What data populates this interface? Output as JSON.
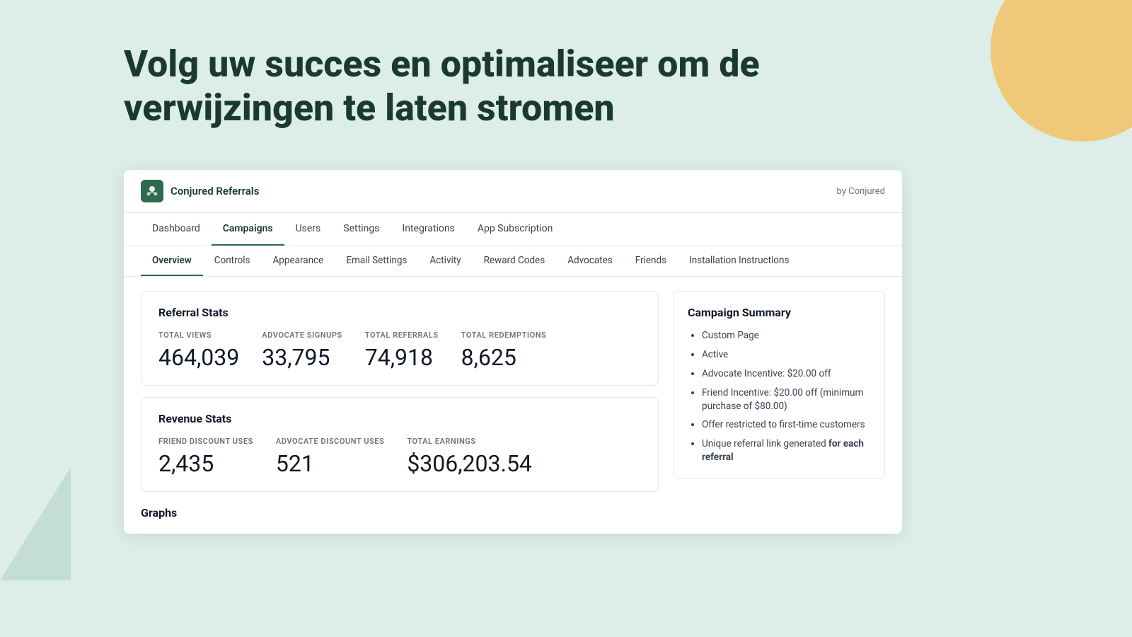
{
  "page": {
    "background_color": "#ddeee8"
  },
  "hero": {
    "title": "Volg uw succes en optimaliseer om de verwijzingen te laten stromen"
  },
  "app": {
    "logo_label": "Conjured Referrals",
    "byline": "by Conjured",
    "top_nav": {
      "items": [
        {
          "label": "Dashboard",
          "active": false
        },
        {
          "label": "Campaigns",
          "active": true
        },
        {
          "label": "Users",
          "active": false
        },
        {
          "label": "Settings",
          "active": false
        },
        {
          "label": "Integrations",
          "active": false
        },
        {
          "label": "App Subscription",
          "active": false
        }
      ]
    },
    "secondary_nav": {
      "items": [
        {
          "label": "Overview",
          "active": true
        },
        {
          "label": "Controls",
          "active": false
        },
        {
          "label": "Appearance",
          "active": false
        },
        {
          "label": "Email Settings",
          "active": false
        },
        {
          "label": "Activity",
          "active": false
        },
        {
          "label": "Reward Codes",
          "active": false
        },
        {
          "label": "Advocates",
          "active": false
        },
        {
          "label": "Friends",
          "active": false
        },
        {
          "label": "Installation Instructions",
          "active": false
        }
      ]
    },
    "referral_stats": {
      "title": "Referral Stats",
      "stats": [
        {
          "label": "TOTAL VIEWS",
          "value": "464,039"
        },
        {
          "label": "ADVOCATE SIGNUPS",
          "value": "33,795"
        },
        {
          "label": "TOTAL REFERRALS",
          "value": "74,918"
        },
        {
          "label": "TOTAL REDEMPTIONS",
          "value": "8,625"
        }
      ]
    },
    "revenue_stats": {
      "title": "Revenue Stats",
      "stats": [
        {
          "label": "FRIEND DISCOUNT USES",
          "value": "2,435"
        },
        {
          "label": "ADVOCATE DISCOUNT USES",
          "value": "521"
        },
        {
          "label": "TOTAL EARNINGS",
          "value": "$306,203.54"
        }
      ]
    },
    "campaign_summary": {
      "title": "Campaign Summary",
      "items": [
        {
          "text": "Custom Page",
          "bold_part": ""
        },
        {
          "text": "Active",
          "bold_part": ""
        },
        {
          "text": "Advocate Incentive: $20.00 off",
          "bold_part": ""
        },
        {
          "text": "Friend Incentive: $20.00 off (minimum purchase of $80.00)",
          "bold_part": ""
        },
        {
          "text": "Offer restricted to first-time customers",
          "bold_part": ""
        },
        {
          "text": "Unique referral link generated for each referral",
          "bold_part": "for each referral"
        }
      ]
    },
    "graphs_section": {
      "title": "Graphs"
    }
  }
}
